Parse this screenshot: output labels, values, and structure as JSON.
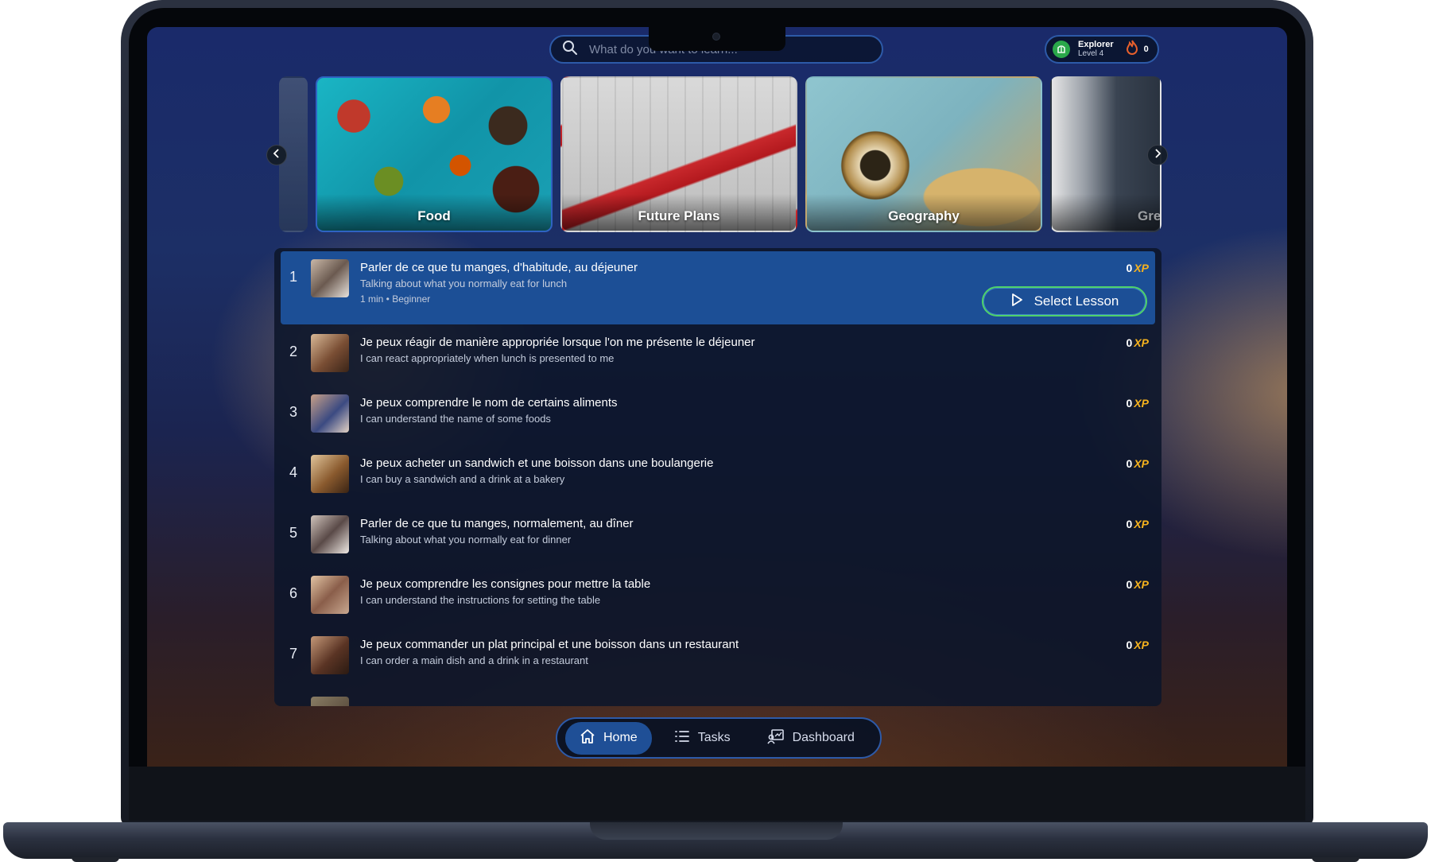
{
  "search": {
    "placeholder": "What do you want to learn..."
  },
  "profile": {
    "name": "Explorer",
    "level": "Level 4",
    "streak": "0"
  },
  "carousel": {
    "categories": [
      {
        "label": ""
      },
      {
        "label": "Food"
      },
      {
        "label": "Future Plans"
      },
      {
        "label": "Geography"
      },
      {
        "label": "Gre"
      }
    ]
  },
  "lessons": [
    {
      "num": "1",
      "title": "Parler de ce que tu manges, d'habitude, au déjeuner",
      "subtitle": "Talking about what you normally eat for lunch",
      "meta": "1 min • Beginner",
      "xp": "0",
      "xp_unit": "XP"
    },
    {
      "num": "2",
      "title": "Je peux réagir de manière appropriée lorsque l'on me présente le déjeuner",
      "subtitle": "I can react appropriately when lunch is presented to me",
      "xp": "0",
      "xp_unit": "XP"
    },
    {
      "num": "3",
      "title": "Je peux comprendre le nom de certains aliments",
      "subtitle": "I can understand the name of some foods",
      "xp": "0",
      "xp_unit": "XP"
    },
    {
      "num": "4",
      "title": "Je peux acheter un sandwich et une boisson dans une boulangerie",
      "subtitle": "I can buy a sandwich and a drink at a bakery",
      "xp": "0",
      "xp_unit": "XP"
    },
    {
      "num": "5",
      "title": "Parler de ce que tu manges, normalement, au dîner",
      "subtitle": "Talking about what you normally eat for dinner",
      "xp": "0",
      "xp_unit": "XP"
    },
    {
      "num": "6",
      "title": "Je peux comprendre les consignes pour mettre la table",
      "subtitle": "I can understand the instructions for setting the table",
      "xp": "0",
      "xp_unit": "XP"
    },
    {
      "num": "7",
      "title": "Je peux commander un plat principal et une boisson dans un restaurant",
      "subtitle": "I can order a main dish and a drink in a restaurant",
      "xp": "0",
      "xp_unit": "XP"
    }
  ],
  "select_lesson_label": "Select Lesson",
  "nav": {
    "home": "Home",
    "tasks": "Tasks",
    "dashboard": "Dashboard"
  },
  "colors": {
    "accent": "#1c4f96",
    "xp": "#f5b21e",
    "select_border": "#4fd26a",
    "streak": "#e8602c",
    "badge": "#2aa84a"
  },
  "icons": {
    "search": "search-icon",
    "badge": "explorer-badge-icon",
    "streak": "flame-icon",
    "prev": "chevron-left-icon",
    "next": "chevron-right-icon",
    "play": "play-icon",
    "home": "home-icon",
    "tasks": "list-icon",
    "dashboard": "dashboard-icon"
  }
}
